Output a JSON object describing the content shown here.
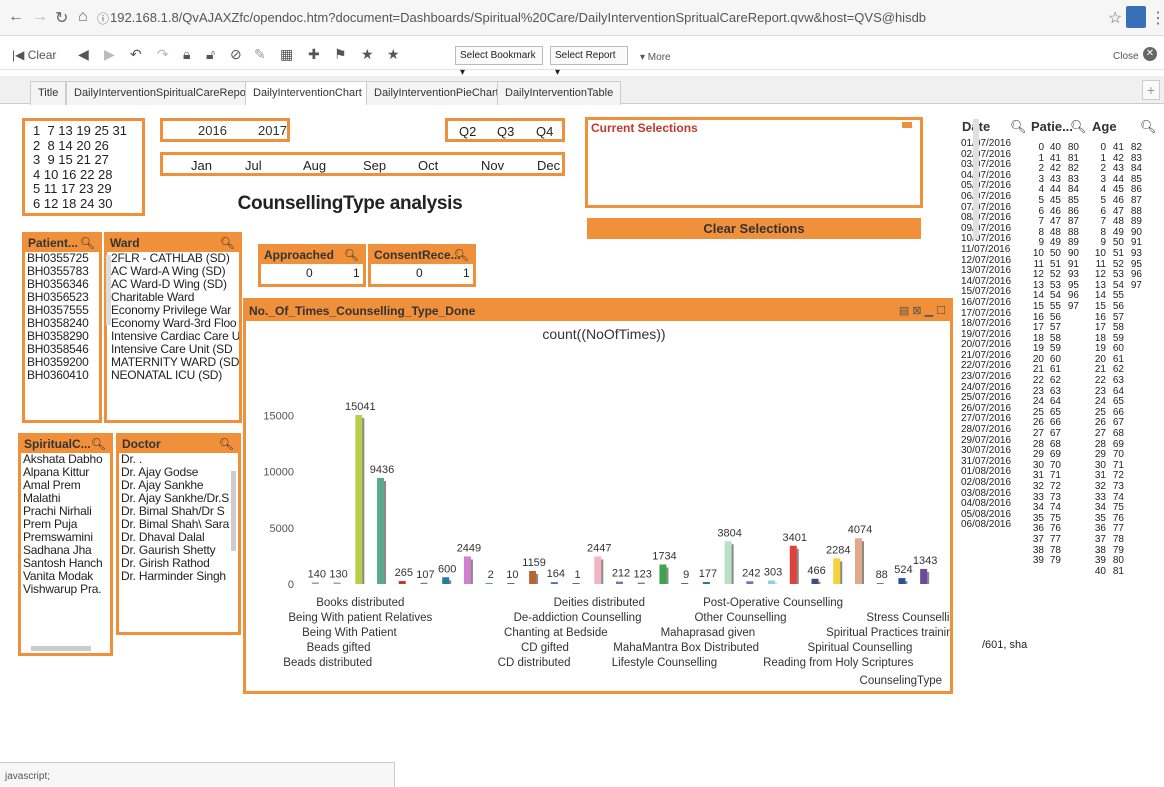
{
  "browser": {
    "url": "192.168.1.8/QvAJAXZfc/opendoc.htm?document=Dashboards/Spiritual%20Care/DailyInterventionSpritualCareReport.qvw&host=QVS@hisdb"
  },
  "toolbar": {
    "clear": "Clear",
    "bookmark": "Select Bookmark ▾",
    "report": "Select Report ▾",
    "more": "▾ More",
    "close": "Close"
  },
  "tabs": [
    "Title",
    "DailyInterventionSpiritualCareReport",
    "DailyInterventionChart",
    "DailyInterventionPieChart",
    "DailyInterventionTable"
  ],
  "days": [
    "1  7 13 19 25 31",
    "2  8 14 20 26",
    "3  9 15 21 27",
    "4 10 16 22 28",
    "5 11 17 23 29",
    "6 12 18 24 30"
  ],
  "years": [
    "2016",
    "2017"
  ],
  "quarters": [
    "Q2",
    "Q3",
    "Q4"
  ],
  "months": [
    "Jan",
    "Jul",
    "Aug",
    "Sep",
    "Oct",
    "Nov",
    "Dec"
  ],
  "current_selections": {
    "title": "Current Selections",
    "clear": "Clear Selections"
  },
  "title_text": "CounsellingType analysis",
  "patient": {
    "title": "Patient...",
    "items": [
      "BH0355725",
      "BH0355783",
      "BH0356346",
      "BH0356523",
      "BH0357555",
      "BH0358240",
      "BH0358290",
      "BH0358546",
      "BH0359200",
      "BH0360410"
    ]
  },
  "ward": {
    "title": "Ward",
    "items": [
      "2FLR - CATHLAB (SD)",
      "AC Ward-A Wing (SD)",
      "AC Ward-D Wing (SD)",
      "Charitable Ward",
      "Economy Privilege War",
      "Economy Ward-3rd Floo",
      "Intensive Cardiac Care U",
      "Intensive Care Unit (SD",
      "MATERNITY WARD (SD",
      "NEONATAL ICU (SD)"
    ]
  },
  "approached": {
    "title": "Approached",
    "v0": "0",
    "v1": "1"
  },
  "consent": {
    "title": "ConsentRece...",
    "v0": "0",
    "v1": "1"
  },
  "spiritual": {
    "title": "SpiritualC...",
    "items": [
      "Akshata Dabho",
      "Alpana Kittur",
      "Amal Prem",
      "Malathi",
      "Prachi Nirhali",
      "Prem Puja",
      "Premswamini",
      "Sadhana Jha",
      "Santosh Hanch",
      "Vanita Modak",
      "Vishwarup Pra."
    ]
  },
  "doctor": {
    "title": "Doctor",
    "items": [
      "Dr. .",
      "Dr. Ajay Godse",
      "Dr. Ajay Sankhe",
      "Dr. Ajay Sankhe/Dr.S",
      "Dr. Bimal Shah/Dr S",
      "Dr. Bimal Shah\\ Sara",
      "Dr. Dhaval Dalal",
      "Dr. Gaurish Shetty",
      "Dr. Girish Rathod",
      "Dr. Harminder Singh"
    ]
  },
  "chart_title_bar": "No._Of_Times_Counselling_Type_Done",
  "chart_data": {
    "type": "bar",
    "title": "count((NoOfTimes))",
    "xlabel": "CounselingType",
    "ylim": [
      0,
      17000
    ],
    "yticks": [
      "0",
      "5000",
      "10000",
      "15000"
    ],
    "bars": [
      {
        "label": "140",
        "value": 140,
        "color": "#7fa8c9"
      },
      {
        "label": "130",
        "value": 130,
        "color": "#7fa8c9"
      },
      {
        "label": "15041",
        "value": 15041,
        "color": "#b5cf4a"
      },
      {
        "label": "9436",
        "value": 9436,
        "color": "#5aa98e"
      },
      {
        "label": "265",
        "value": 265,
        "color": "#c0392b"
      },
      {
        "label": "107",
        "value": 107,
        "color": "#8e6aa8"
      },
      {
        "label": "600",
        "value": 600,
        "color": "#2a7b9b"
      },
      {
        "label": "2449",
        "value": 2449,
        "color": "#d27fd0"
      },
      {
        "label": "2",
        "value": 2,
        "color": "#5b8ec7"
      },
      {
        "label": "10",
        "value": 10,
        "color": "#666"
      },
      {
        "label": "1159",
        "value": 1159,
        "color": "#b8652d"
      },
      {
        "label": "164",
        "value": 164,
        "color": "#4b6eaf"
      },
      {
        "label": "1",
        "value": 1,
        "color": "#666"
      },
      {
        "label": "2447",
        "value": 2447,
        "color": "#f2b5c2"
      },
      {
        "label": "212",
        "value": 212,
        "color": "#6b7fa8"
      },
      {
        "label": "123",
        "value": 123,
        "color": "#7a7a7a"
      },
      {
        "label": "1734",
        "value": 1734,
        "color": "#3fa34d"
      },
      {
        "label": "9",
        "value": 9,
        "color": "#666"
      },
      {
        "label": "177",
        "value": 177,
        "color": "#1f7f8a"
      },
      {
        "label": "3804",
        "value": 3804,
        "color": "#b9e2c4"
      },
      {
        "label": "242",
        "value": 242,
        "color": "#7b6ec2"
      },
      {
        "label": "303",
        "value": 303,
        "color": "#8fcfe0"
      },
      {
        "label": "3401",
        "value": 3401,
        "color": "#e0413a"
      },
      {
        "label": "466",
        "value": 466,
        "color": "#3f4c8c"
      },
      {
        "label": "2284",
        "value": 2284,
        "color": "#f4d33b"
      },
      {
        "label": "4074",
        "value": 4074,
        "color": "#e2a98b"
      },
      {
        "label": "88",
        "value": 88,
        "color": "#7a7a7a"
      },
      {
        "label": "524",
        "value": 524,
        "color": "#2d4f9b"
      },
      {
        "label": "1343",
        "value": 1343,
        "color": "#6a4c9c"
      }
    ],
    "categories": [
      {
        "text": "Books distributed",
        "row": 0,
        "x": 2
      },
      {
        "text": "Being With patient Relatives",
        "row": 1,
        "x": 2
      },
      {
        "text": "Being With Patient",
        "row": 2,
        "x": 1.5
      },
      {
        "text": "Beads gifted",
        "row": 3,
        "x": 1
      },
      {
        "text": "Beads distributed",
        "row": 4,
        "x": 0.5
      },
      {
        "text": "Deities distributed",
        "row": 0,
        "x": 13
      },
      {
        "text": "De-addiction Counselling",
        "row": 1,
        "x": 12
      },
      {
        "text": "Chanting at Bedside",
        "row": 2,
        "x": 11
      },
      {
        "text": "CD gifted",
        "row": 3,
        "x": 10.5
      },
      {
        "text": "CD distributed",
        "row": 4,
        "x": 10
      },
      {
        "text": "Post-Operative Counselling",
        "row": 0,
        "x": 21
      },
      {
        "text": "Other Counselling",
        "row": 1,
        "x": 19.5
      },
      {
        "text": "Mahaprasad given",
        "row": 2,
        "x": 18
      },
      {
        "text": "MahaMantra  Box  Distributed",
        "row": 3,
        "x": 17
      },
      {
        "text": "Lifestyle Counselling",
        "row": 4,
        "x": 16
      },
      {
        "text": "Stress Counselling",
        "row": 1,
        "x": 27.5
      },
      {
        "text": "Spiritual Practices training",
        "row": 2,
        "x": 26.5
      },
      {
        "text": "Spiritual Counselling",
        "row": 3,
        "x": 25
      },
      {
        "text": "Reading from Holy Scriptures",
        "row": 4,
        "x": 24
      }
    ]
  },
  "date_list": {
    "title": "Date",
    "items": [
      "01/07/2016",
      "02/07/2016",
      "03/07/2016",
      "04/07/2016",
      "05/07/2016",
      "06/07/2016",
      "07/07/2016",
      "08/07/2016",
      "09/07/2016",
      "10/07/2016",
      "11/07/2016",
      "12/07/2016",
      "13/07/2016",
      "14/07/2016",
      "15/07/2016",
      "16/07/2016",
      "17/07/2016",
      "18/07/2016",
      "19/07/2016",
      "20/07/2016",
      "21/07/2016",
      "22/07/2016",
      "23/07/2016",
      "24/07/2016",
      "25/07/2016",
      "26/07/2016",
      "27/07/2016",
      "28/07/2016",
      "29/07/2016",
      "30/07/2016",
      "31/07/2016",
      "01/08/2016",
      "02/08/2016",
      "03/08/2016",
      "04/08/2016",
      "05/08/2016",
      "06/08/2016"
    ],
    "extra": "/601, sha"
  },
  "patient_list": {
    "title": "Patie...",
    "col1": [
      "0",
      "1",
      "2",
      "3",
      "4",
      "5",
      "6",
      "7",
      "8",
      "9",
      "10",
      "11",
      "12",
      "13",
      "14",
      "15",
      "16",
      "17",
      "18",
      "19",
      "20",
      "21",
      "22",
      "23",
      "24",
      "25",
      "26",
      "27",
      "28",
      "29",
      "30",
      "31",
      "32",
      "33",
      "34",
      "35",
      "36",
      "37",
      "38",
      "39"
    ],
    "col2": [
      "40",
      "41",
      "42",
      "43",
      "44",
      "45",
      "46",
      "47",
      "48",
      "49",
      "50",
      "51",
      "52",
      "53",
      "54",
      "55",
      "56",
      "57",
      "58",
      "59",
      "60",
      "61",
      "62",
      "63",
      "64",
      "65",
      "66",
      "67",
      "68",
      "69",
      "70",
      "71",
      "72",
      "73",
      "74",
      "75",
      "76",
      "77",
      "78",
      "79"
    ],
    "col3": [
      "80",
      "81",
      "82",
      "83",
      "84",
      "85",
      "86",
      "87",
      "88",
      "89",
      "90",
      "91",
      "93",
      "95",
      "96",
      "97"
    ]
  },
  "age_list": {
    "title": "Age",
    "col1": [
      "0",
      "1",
      "2",
      "3",
      "4",
      "5",
      "6",
      "7",
      "8",
      "9",
      "10",
      "11",
      "12",
      "13",
      "14",
      "15",
      "16",
      "17",
      "18",
      "19",
      "20",
      "21",
      "22",
      "23",
      "24",
      "25",
      "26",
      "27",
      "28",
      "29",
      "30",
      "31",
      "32",
      "33",
      "34",
      "35",
      "36",
      "37",
      "38",
      "39",
      "40"
    ],
    "col2": [
      "41",
      "42",
      "43",
      "44",
      "45",
      "46",
      "47",
      "48",
      "49",
      "50",
      "51",
      "52",
      "53",
      "54",
      "55",
      "56",
      "57",
      "58",
      "59",
      "60",
      "61",
      "62",
      "63",
      "64",
      "65",
      "66",
      "67",
      "68",
      "69",
      "70",
      "71",
      "72",
      "73",
      "74",
      "75",
      "76",
      "77",
      "78",
      "79",
      "80",
      "81"
    ],
    "col3": [
      "82",
      "83",
      "84",
      "85",
      "86",
      "87",
      "88",
      "89",
      "90",
      "91",
      "93",
      "95",
      "96",
      "97"
    ]
  },
  "status": "javascript;"
}
